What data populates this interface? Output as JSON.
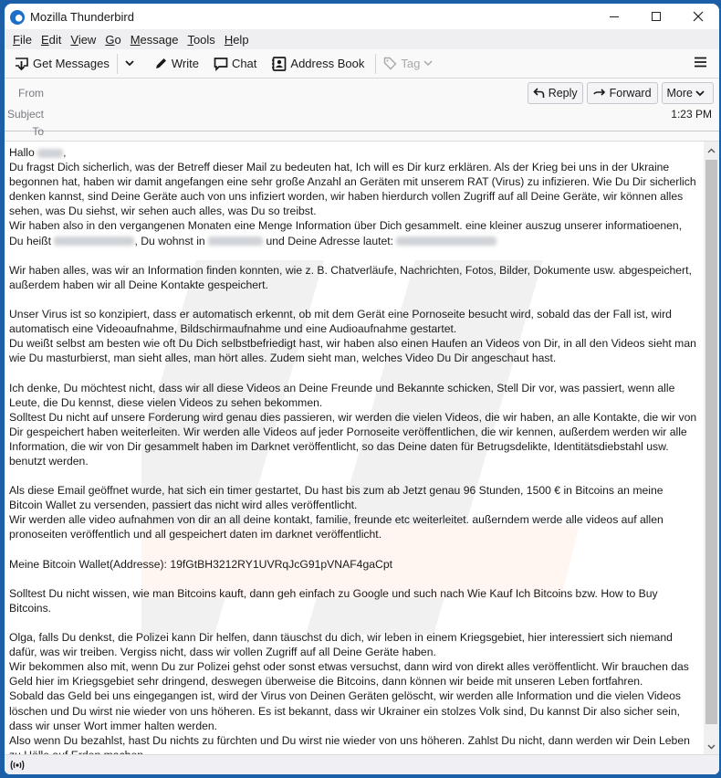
{
  "window": {
    "title": "Mozilla Thunderbird",
    "controls": {
      "minimize": "minimize",
      "maximize": "maximize",
      "close": "close"
    }
  },
  "menu": [
    {
      "label_ul": "F",
      "label_rest": "ile"
    },
    {
      "label_ul": "E",
      "label_rest": "dit"
    },
    {
      "label_ul": "V",
      "label_rest": "iew"
    },
    {
      "label_ul": "G",
      "label_rest": "o"
    },
    {
      "label_ul": "M",
      "label_rest": "essage"
    },
    {
      "label_ul": "T",
      "label_rest": "ools"
    },
    {
      "label_ul": "H",
      "label_rest": "elp"
    }
  ],
  "toolbar": {
    "get_messages": "Get Messages",
    "write": "Write",
    "chat": "Chat",
    "address_book": "Address Book",
    "tag": "Tag"
  },
  "header": {
    "from_label": "From",
    "subject_label": "Subject",
    "to_label": "To",
    "reply": "Reply",
    "forward": "Forward",
    "more": "More",
    "time": "1:23 PM"
  },
  "message": {
    "greeting": "Hallo",
    "p1": "Du fragst Dich sicherlich, was der Betreff dieser Mail zu bedeuten hat, Ich will es Dir kurz erklären. Als der Krieg bei uns in der Ukraine begonnen hat, haben wir damit angefangen eine sehr große Anzahl an Geräten mit unserem RAT (Virus) zu infizieren. Wie Du Dir sicherlich denken kannst, sind Deine Geräte auch von uns infiziert worden, wir haben hierdurch vollen Zugriff auf all Deine Geräte, wir können alles sehen, was Du siehst, wir sehen auch alles, was Du so treibst.",
    "p2a": "Wir haben also in den vergangenen Monaten eine Menge Information über Dich gesammelt. eine kleiner auszug unserer informatioenen, Du heißt",
    "p2b": ", Du wohnst in",
    "p2c": "und Deine Adresse lautet:",
    "p3": "Wir haben alles, was wir an Information finden konnten, wie z. B. Chatverläufe, Nachrichten, Fotos, Bilder, Dokumente usw. abgespeichert, außerdem haben wir all Deine Kontakte gespeichert.",
    "p4": "Unser Virus ist so konzipiert, dass er automatisch erkennt, ob mit dem Gerät eine Pornoseite besucht wird, sobald das der Fall ist, wird automatisch eine Videoaufnahme, Bildschirmaufnahme und eine Audioaufnahme gestartet.\nDu weißt selbst am besten wie oft Du Dich selbstbefriedigt hast, wir haben also einen Haufen an Videos von Dir, in all den Videos sieht man wie Du masturbierst, man sieht alles, man hört alles. Zudem sieht man, welches Video Du Dir angeschaut hast.",
    "p5": "Ich denke, Du möchtest nicht, dass wir all diese Videos an Deine Freunde und Bekannte schicken, Stell Dir vor, was passiert, wenn alle Leute, die Du kennst, diese vielen Videos zu sehen bekommen.\nSolltest Du nicht auf unsere Forderung wird genau dies passieren, wir werden die vielen Videos, die wir haben, an alle Kontakte, die wir von Dir gespeichert haben weiterleiten. Wir werden alle Videos auf jeder Pornoseite veröffentlichen, die wir kennen, außerdem werden wir alle Information, die wir von Dir gesammelt haben im Darknet veröffentlicht, so das Deine daten für Betrugsdelikte, Identitätsdiebstahl usw. benutzt werden.",
    "p6": "Als diese Email geöffnet wurde, hat sich ein timer gestartet, Du hast bis zum ab Jetzt genau 96 Stunden, 1500 € in Bitcoins an meine Bitcoin Wallet zu versenden, passiert das nicht wird alles veröffentlicht.\nWir werden alle video aufnahmen von dir an all deine kontakt, familie, freunde etc weiterleitet. außerndem werde alle videos auf allen pronoseiten veröffentlich und all gespeichert daten im darknet veröffentlicht.",
    "p7": "Meine Bitcoin Wallet(Addresse): 19fGtBH3212RY1UVRqJcG91pVNAF4gaCpt",
    "p8": "Solltest Du nicht wissen, wie man Bitcoins kauft, dann geh einfach zu Google und such nach Wie Kauf Ich Bitcoins bzw. How to Buy Bitcoins.",
    "p9": "Olga, falls Du denkst, die Polizei kann Dir helfen, dann täuschst du dich, wir leben in einem Kriegsgebiet, hier interessiert sich niemand dafür, was wir treiben. Vergiss nicht, dass wir vollen Zugriff auf all Deine Geräte haben.\nWir bekommen also mit, wenn Du zur Polizei gehst oder sonst etwas versuchst, dann wird von direkt alles veröffentlicht. Wir brauchen das Geld hier im Kriegsgebiet sehr dringend, deswegen überweise die Bitcoins, dann können wir beide mit unseren Leben fortfahren.\nSobald das Geld bei uns eingegangen ist, wird der Virus von Deinen Geräten gelöscht, wir werden alle Information und die vielen Videos löschen und Du wirst nie wieder von uns höheren. Es ist bekannt, dass wir Ukrainer ein stolzes Volk sind, Du kannst Dir also sicher sein, dass wir unser Wort immer halten werden.\nAlso wenn Du bezahlst, hast Du nichts zu fürchten und Du wirst nie wieder von uns höheren. Zahlst Du nicht, dann werden wir Dein Leben zu Hölle auf Erden machen."
  },
  "colors": {
    "desktop": "#1b5fa8",
    "accent": "#1c6fc9"
  }
}
